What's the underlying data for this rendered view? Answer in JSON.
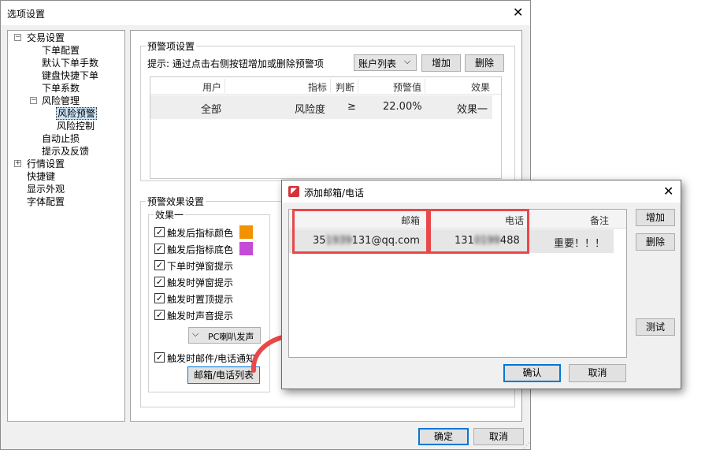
{
  "main_window": {
    "title": "选项设置",
    "ok_label": "确定",
    "cancel_label": "取消"
  },
  "tree": {
    "trading_settings": "交易设置",
    "order_config": "下单配置",
    "default_order_qty": "默认下单手数",
    "keyboard_quick_order": "键盘快捷下单",
    "order_coefficient": "下单系数",
    "risk_management": "风险管理",
    "risk_alert": "风险预警",
    "risk_control": "风险控制",
    "auto_stop_loss": "自动止损",
    "hints_feedback": "提示及反馈",
    "market_settings": "行情设置",
    "shortcuts": "快捷键",
    "display_appearance": "显示外观",
    "font_config": "字体配置"
  },
  "alert_items": {
    "group_title": "预警项设置",
    "hint": "提示: 通过点击右侧按钮增加或删除预警项",
    "account_list_select": "账户列表",
    "add_label": "增加",
    "delete_label": "删除",
    "columns": [
      "用户",
      "指标",
      "判断",
      "预警值",
      "效果"
    ],
    "rows": [
      {
        "user": "全部",
        "indicator": "风险度",
        "judge": "≥",
        "value": "22.00%",
        "effect": "效果一"
      }
    ]
  },
  "alert_effects": {
    "group_title": "预警效果设置",
    "effect_group_title": "效果一",
    "checkboxes": [
      {
        "label": "触发后指标颜色",
        "checked": true
      },
      {
        "label": "触发后指标底色",
        "checked": true
      },
      {
        "label": "下单时弹窗提示",
        "checked": true
      },
      {
        "label": "触发时弹窗提示",
        "checked": true
      },
      {
        "label": "触发时置顶提示",
        "checked": true
      },
      {
        "label": "触发时声音提示",
        "checked": true
      }
    ],
    "sound_select": "PC喇叭发声",
    "email_notify_label": "触发时邮件/电话通知",
    "email_list_button": "邮箱/电话列表",
    "indicator_color": "#f39200",
    "indicator_bg_color": "#c34bd6"
  },
  "popup": {
    "title": "添加邮箱/电话",
    "columns": [
      "邮箱",
      "电话",
      "备注"
    ],
    "rows": [
      {
        "email_prefix": "35",
        "email_hidden": "1939",
        "email_suffix": "131@qq.com",
        "phone_prefix": "131",
        "phone_hidden": "0199",
        "phone_suffix": "488",
        "note": "重要！！！"
      }
    ],
    "add_label": "增加",
    "delete_label": "删除",
    "test_label": "测试",
    "ok_label": "确认",
    "cancel_label": "取消"
  },
  "colors": {
    "highlight_box": "#e8484a",
    "arrow": "#e8484a",
    "selection": "#cce4f7",
    "default_button_border": "#0078d7"
  }
}
